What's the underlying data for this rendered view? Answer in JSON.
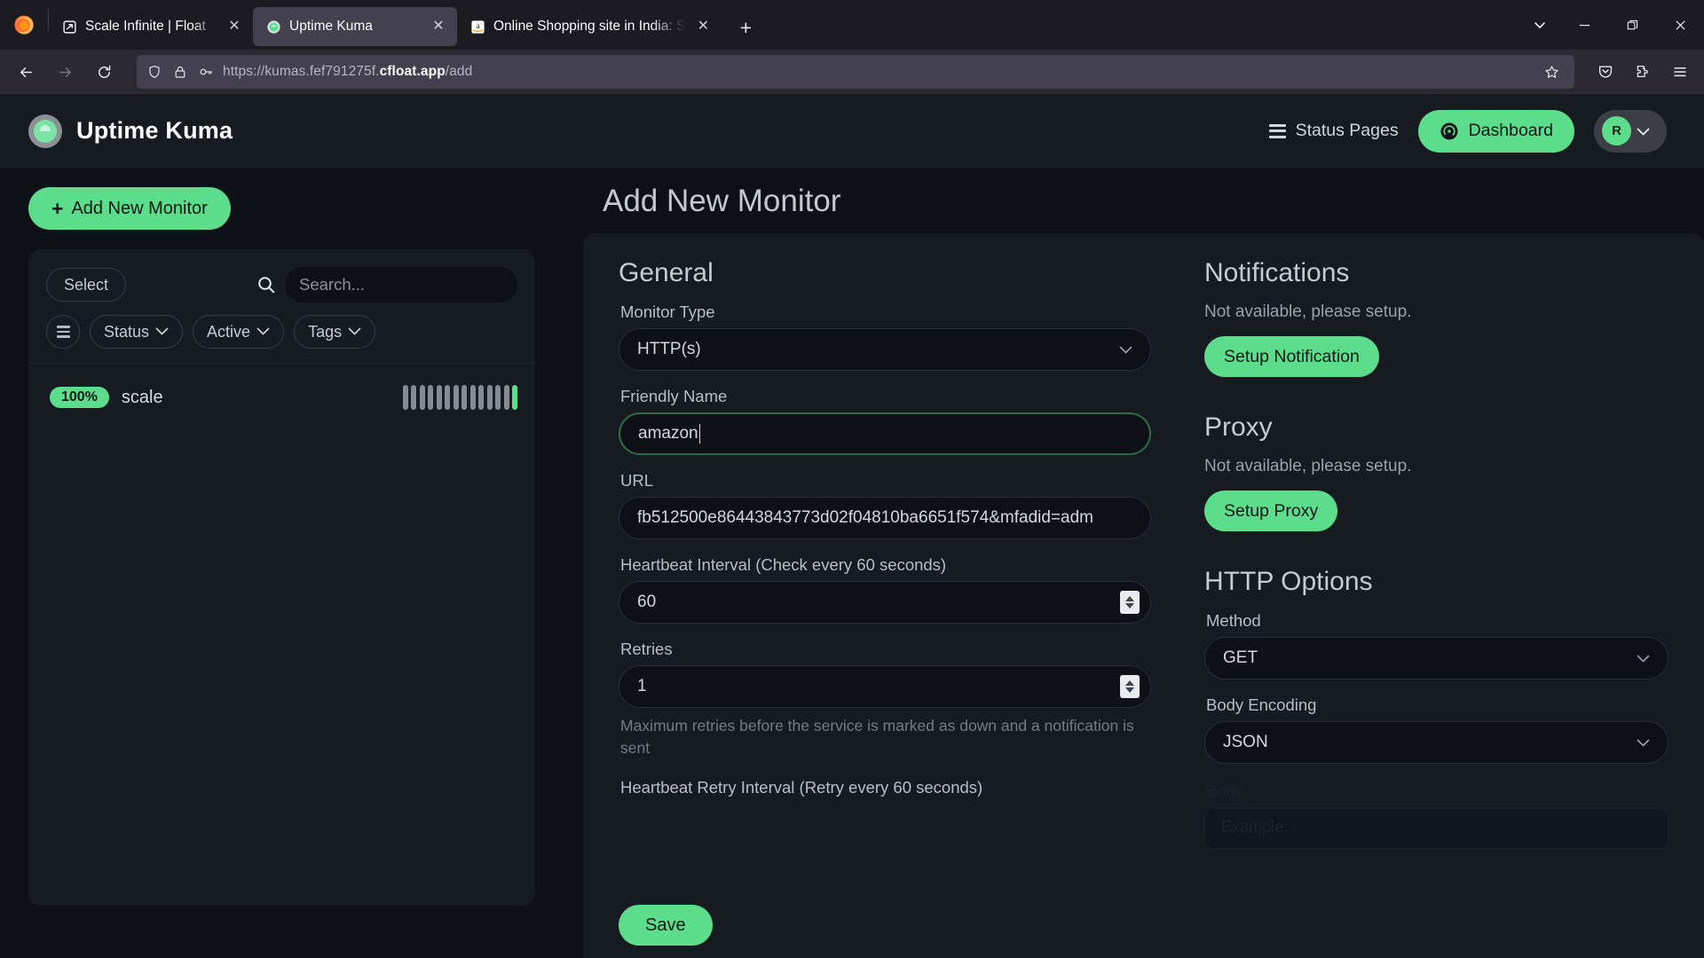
{
  "browser": {
    "tabs": [
      {
        "title": "Scale Infinite | Float",
        "favicon": "float-icon",
        "active": false
      },
      {
        "title": "Uptime Kuma",
        "favicon": "uptime-kuma-icon",
        "active": true
      },
      {
        "title": "Online Shopping site in India: S",
        "favicon": "amazon-icon",
        "active": false
      }
    ],
    "new_tab_label": "+",
    "close_label": "✕",
    "url": "https://kumas.fef791275f.",
    "url_bold": "cfloat.app",
    "url_tail": "/add",
    "toolbar_icons": [
      "back-icon",
      "forward-icon",
      "reload-icon",
      "shield-icon",
      "lock-icon",
      "key-icon",
      "bookmark-star-icon",
      "pocket-icon",
      "extensions-icon",
      "app-menu-icon"
    ],
    "window_controls": [
      "list-all-tabs-icon",
      "minimize-icon",
      "maximize-icon",
      "close-window-icon"
    ]
  },
  "header": {
    "brand": "Uptime Kuma",
    "status_pages": "Status Pages",
    "dashboard": "Dashboard",
    "avatar_letter": "R"
  },
  "sidebar": {
    "add_new_monitor": "Add New Monitor",
    "select_label": "Select",
    "search_placeholder": "Search...",
    "search_value": "",
    "filters": [
      {
        "label": "Status"
      },
      {
        "label": "Active"
      },
      {
        "label": "Tags"
      }
    ],
    "monitors": [
      {
        "uptime": "100%",
        "name": "scale",
        "heartbeats": [
          "down",
          "down",
          "down",
          "down",
          "down",
          "down",
          "down",
          "down",
          "down",
          "down",
          "down",
          "down",
          "down",
          "up"
        ]
      }
    ]
  },
  "main": {
    "page_title": "Add New Monitor",
    "general": {
      "section_title": "General",
      "monitor_type_label": "Monitor Type",
      "monitor_type_value": "HTTP(s)",
      "friendly_name_label": "Friendly Name",
      "friendly_name_value": "amazon",
      "url_label": "URL",
      "url_value": "fb512500e86443843773d02f04810ba6651f574&mfadid=adm",
      "heartbeat_interval_label": "Heartbeat Interval (Check every 60 seconds)",
      "heartbeat_interval_value": "60",
      "retries_label": "Retries",
      "retries_value": "1",
      "retries_hint": "Maximum retries before the service is marked as down and a notification is sent",
      "heartbeat_retry_label": "Heartbeat Retry Interval (Retry every 60 seconds)"
    },
    "notifications": {
      "section_title": "Notifications",
      "empty_text": "Not available, please setup.",
      "setup_button": "Setup Notification"
    },
    "proxy": {
      "section_title": "Proxy",
      "empty_text": "Not available, please setup.",
      "setup_button": "Setup Proxy"
    },
    "http_options": {
      "section_title": "HTTP Options",
      "method_label": "Method",
      "method_value": "GET",
      "body_encoding_label": "Body Encoding",
      "body_encoding_value": "JSON",
      "body_label": "Body",
      "body_placeholder": "Example:"
    },
    "save_button": "Save"
  },
  "colors": {
    "accent_green": "#5cdd8b",
    "page_bg": "#0d1117",
    "card_bg": "#161b22",
    "focus_ring": "#2e6b43"
  }
}
